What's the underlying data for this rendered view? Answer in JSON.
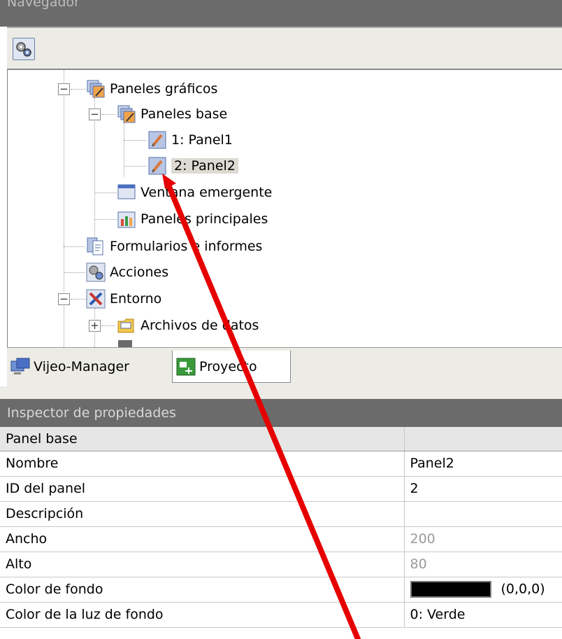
{
  "navigator": {
    "title": "Navegador"
  },
  "tree": {
    "items": [
      {
        "label": "Paneles gráficos"
      },
      {
        "label": "Paneles base"
      },
      {
        "label": "1: Panel1"
      },
      {
        "label": "2: Panel2"
      },
      {
        "label": "Ventana emergente"
      },
      {
        "label": "Paneles principales"
      },
      {
        "label": "Formularios e informes"
      },
      {
        "label": "Acciones"
      },
      {
        "label": "Entorno"
      },
      {
        "label": "Archivos de datos"
      }
    ]
  },
  "tabs": [
    {
      "label": "Vijeo-Manager"
    },
    {
      "label": "Proyecto"
    }
  ],
  "inspector": {
    "title": "Inspector de propiedades",
    "group": "Panel base",
    "rows": [
      {
        "name": "Nombre",
        "value": "Panel2"
      },
      {
        "name": "ID del panel",
        "value": "2"
      },
      {
        "name": "Descripción",
        "value": ""
      },
      {
        "name": "Ancho",
        "value": "200"
      },
      {
        "name": "Alto",
        "value": "80"
      },
      {
        "name": "Color de fondo",
        "value": "(0,0,0)"
      },
      {
        "name": "Color de la luz de fondo",
        "value": "0: Verde"
      }
    ]
  },
  "colors": {
    "annotation": "#e60000",
    "header": "#6b6b6b",
    "selection": "#dcdad2"
  }
}
